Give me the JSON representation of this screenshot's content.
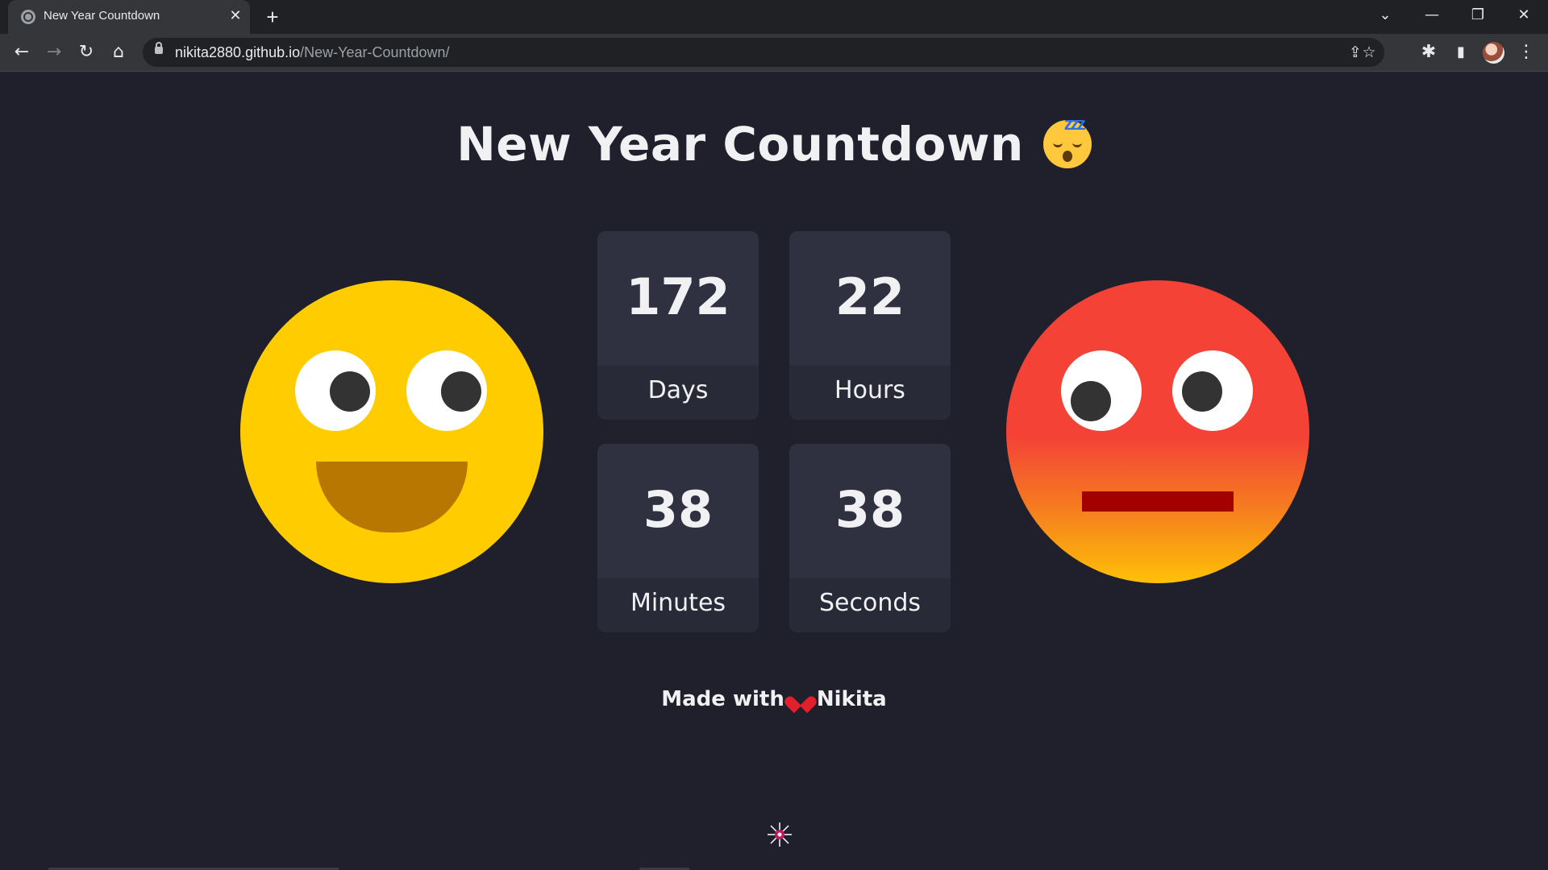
{
  "browser": {
    "tab_title": "New Year Countdown",
    "tab_close": "✕",
    "new_tab": "+",
    "url_host": "nikita2880.github.io",
    "url_path": "/New-Year-Countdown/",
    "controls": {
      "tab_search": "⌄",
      "minimize": "—",
      "restore": "❐",
      "close": "✕"
    },
    "toolbar": {
      "back": "←",
      "forward": "→",
      "reload": "↻",
      "home": "⌂",
      "share": "⇪",
      "bookmark": "☆",
      "extensions": "✱",
      "side_panel": "▮",
      "menu": "⋮"
    }
  },
  "page": {
    "title": "New Year Countdown",
    "title_emoji": "sleeping-face-icon",
    "zzz": "zzz",
    "countdown": [
      {
        "value": "172",
        "label": "Days"
      },
      {
        "value": "22",
        "label": "Hours"
      },
      {
        "value": "38",
        "label": "Minutes"
      },
      {
        "value": "38",
        "label": "Seconds"
      }
    ],
    "footer": {
      "made_with": "Made with",
      "heart_icon": "heart-icon",
      "author": "Nikita"
    }
  },
  "colors": {
    "background": "#1f202b",
    "box": "#2f3141",
    "box_lower": "#282a38",
    "happy_face": "#ffcc00",
    "happy_mouth": "#b87700",
    "angry_top": "#f44336",
    "angry_bottom": "#ffc107",
    "angry_mouth": "#a30000",
    "text": "#f1f1f4"
  }
}
